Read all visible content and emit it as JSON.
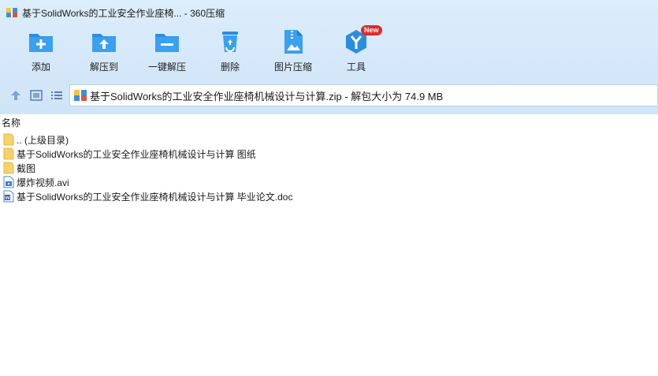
{
  "window": {
    "title": "基于SolidWorks的工业安全作业座椅... - 360压缩"
  },
  "toolbar": {
    "add_label": "添加",
    "extract_to_label": "解压到",
    "one_click_extract_label": "一键解压",
    "delete_label": "删除",
    "image_compress_label": "图片压缩",
    "tools_label": "工具",
    "tools_badge": "New"
  },
  "address": {
    "path": "基于SolidWorks的工业安全作业座椅机械设计与计算.zip - 解包大小为 74.9 MB"
  },
  "list": {
    "column_name": "名称",
    "items": [
      {
        "name": ".. (上级目录)",
        "type": "folder"
      },
      {
        "name": "基于SolidWorks的工业安全作业座椅机械设计与计算 图纸",
        "type": "folder"
      },
      {
        "name": "截图",
        "type": "folder"
      },
      {
        "name": "爆炸视频.avi",
        "type": "video"
      },
      {
        "name": "基于SolidWorks的工业安全作业座椅机械设计与计算 毕业论文.doc",
        "type": "doc"
      }
    ]
  },
  "colors": {
    "chrome_bg": "#d6e9fa",
    "icon_blue": "#2a8de0",
    "folder_yellow": "#f6d36a",
    "badge_red": "#e02a2a"
  }
}
